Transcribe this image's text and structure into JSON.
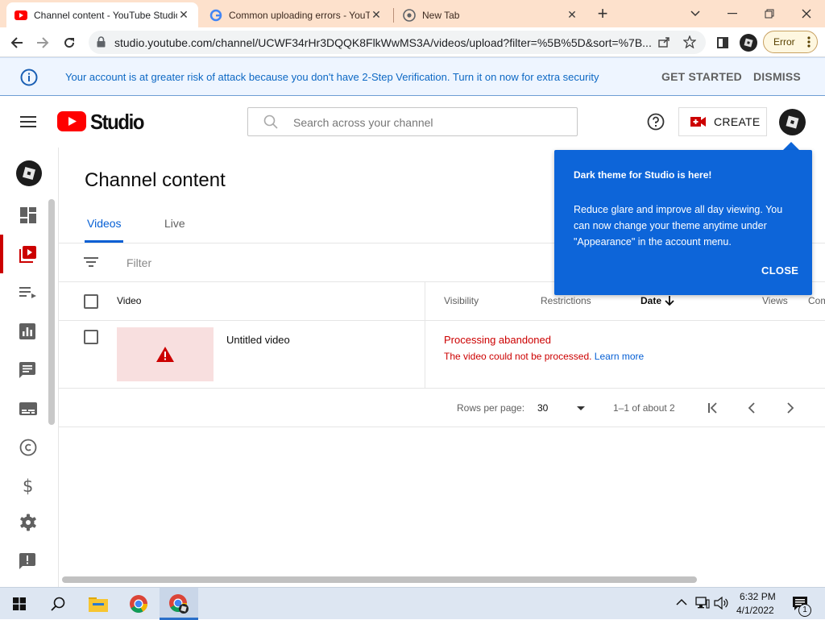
{
  "browser": {
    "tabs": [
      {
        "title": "Channel content - YouTube Studio"
      },
      {
        "title": "Common uploading errors - YouTube"
      },
      {
        "title": "New Tab"
      }
    ],
    "url": "studio.youtube.com/channel/UCWF34rHr3DQQK8FlkWwMS3A/videos/upload?filter=%5B%5D&sort=%7B...",
    "error_pill": "Error"
  },
  "banner": {
    "message": "Your account is at greater risk of attack because you don't have 2-Step Verification. Turn it on now for extra security",
    "get_started": "GET STARTED",
    "dismiss": "DISMISS"
  },
  "header": {
    "logo_text": "Studio",
    "search_placeholder": "Search across your channel",
    "create_label": "CREATE"
  },
  "page": {
    "title": "Channel content",
    "tabs": [
      "Videos",
      "Live"
    ],
    "filter_placeholder": "Filter"
  },
  "table": {
    "columns": [
      "Video",
      "Visibility",
      "Restrictions",
      "Date",
      "Views",
      "Com"
    ],
    "rows": [
      {
        "title": "Untitled video",
        "status": "Processing abandoned",
        "status_detail": "The video could not be processed.",
        "status_link": "Learn more"
      }
    ]
  },
  "pagination": {
    "rows_per_page_label": "Rows per page:",
    "rows_per_page": "30",
    "range": "1–1 of about 2"
  },
  "popup": {
    "title": "Dark theme for Studio is here!",
    "body": "Reduce glare and improve all day viewing. You can now change your theme anytime under \"Appearance\" in the account menu.",
    "close": "CLOSE"
  },
  "taskbar": {
    "time": "6:32 PM",
    "date": "4/1/2022",
    "notification_count": "1"
  },
  "colors": {
    "accent_blue": "#065fd4",
    "popup_blue": "#0d65d9",
    "youtube_red": "#ff0000",
    "error_red": "#cc0000",
    "tabbar_bg": "#fde1cc"
  }
}
